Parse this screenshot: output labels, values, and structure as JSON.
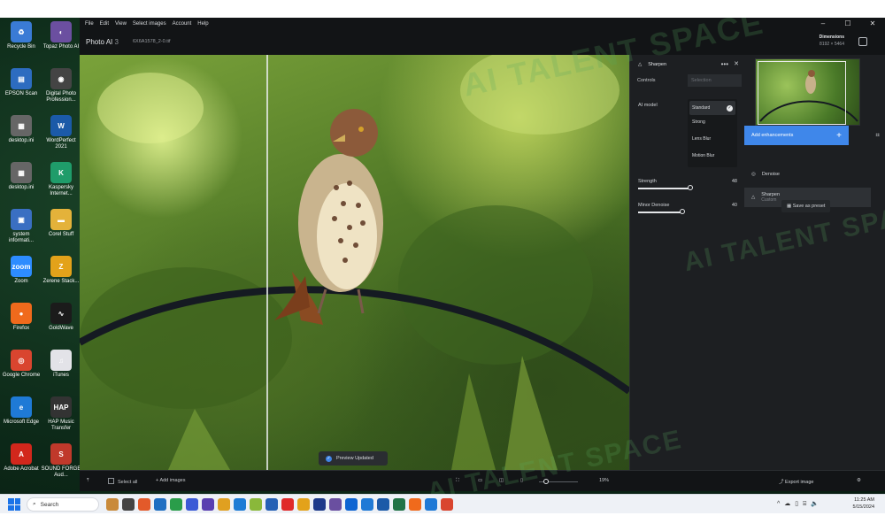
{
  "desktop": {
    "icons": [
      {
        "label": "Recycle Bin",
        "color": "#3a7bd5",
        "glyph": "♻"
      },
      {
        "label": "Topaz Photo AI",
        "color": "#6b4fa0",
        "glyph": "◐"
      },
      {
        "label": "EPSON Scan",
        "color": "#2d6cc0",
        "glyph": "▤"
      },
      {
        "label": "Digital Photo Profession...",
        "color": "#444",
        "glyph": "◉"
      },
      {
        "label": "desktop.ini",
        "color": "#666",
        "glyph": "▦"
      },
      {
        "label": "WordPerfect 2021",
        "color": "#1b5aa8",
        "glyph": "W"
      },
      {
        "label": "desktop.ini",
        "color": "#666",
        "glyph": "▦"
      },
      {
        "label": "Kaspersky Internet...",
        "color": "#1f9c6a",
        "glyph": "K"
      },
      {
        "label": "system informati...",
        "color": "#3a6fc2",
        "glyph": "▣"
      },
      {
        "label": "Corel Stuff",
        "color": "#e4b23a",
        "glyph": "▬"
      },
      {
        "label": "Zoom",
        "color": "#2d8cff",
        "glyph": "zoom"
      },
      {
        "label": "Zerene Stack...",
        "color": "#e3a21a",
        "glyph": "Z"
      },
      {
        "label": "Firefox",
        "color": "#f06a1c",
        "glyph": "●"
      },
      {
        "label": "GoldWave",
        "color": "#1b1b1b",
        "glyph": "∿"
      },
      {
        "label": "Google Chrome",
        "color": "#d9452f",
        "glyph": "◎"
      },
      {
        "label": "iTunes",
        "color": "#e3e3e8",
        "glyph": "♫"
      },
      {
        "label": "Microsoft Edge",
        "color": "#1f7ad6",
        "glyph": "e"
      },
      {
        "label": "HAP Music Transfer",
        "color": "#333",
        "glyph": "HAP"
      },
      {
        "label": "Adobe Acrobat",
        "color": "#d2271c",
        "glyph": "A"
      },
      {
        "label": "SOUND FORGE Aud...",
        "color": "#c0392b",
        "glyph": "S"
      }
    ]
  },
  "menu": {
    "items": [
      "File",
      "Edit",
      "View",
      "Select images",
      "Account",
      "Help"
    ]
  },
  "window_controls": {
    "min": "–",
    "max": "☐",
    "close": "✕"
  },
  "header": {
    "app_name": "Photo AI",
    "app_version": "3",
    "file_name": "6X6A1578_2-0.tif",
    "dimensions_label": "Dimensions",
    "dimensions_value": "8192 × 5464"
  },
  "preview": {
    "toast": "Preview Updated",
    "split_percent": 34
  },
  "sharpen_panel": {
    "title": "Sharpen",
    "more": "•••",
    "close": "✕",
    "tabs": [
      "Controls",
      "Selection"
    ],
    "ai_model_label": "AI model",
    "models": [
      "Standard",
      "Strong",
      "Lens Blur",
      "Motion Blur"
    ],
    "selected_model": "Standard",
    "sliders": [
      {
        "label": "Strength",
        "value": 48
      },
      {
        "label": "Minor Denoise",
        "value": 40
      }
    ]
  },
  "right_panel": {
    "add_enhancements": "Add enhancements",
    "enhancements": [
      {
        "name": "Denoise",
        "sub": ""
      },
      {
        "name": "Sharpen",
        "sub": "Custom"
      }
    ],
    "save_preset": "Save as preset"
  },
  "bottom_bar": {
    "select_all": "Select all",
    "add_images": "Add images",
    "zoom": "19%",
    "export": "Export image"
  },
  "watermark": {
    "text": "AI TALENT SPACE"
  },
  "taskbar": {
    "search_placeholder": "Search",
    "time": "11:25 AM",
    "date": "5/15/2024",
    "app_colors": [
      "#c98a3a",
      "#444",
      "#e35a2a",
      "#1f6fc2",
      "#2a9d4a",
      "#3b5bd6",
      "#5a3fb0",
      "#e0a020",
      "#1c7bd5",
      "#8ab83a",
      "#2561b5",
      "#e02a2a",
      "#e3a21a",
      "#1e3a8a",
      "#6a4fa0",
      "#0d64d2",
      "#1f7ad6",
      "#1b5aa8",
      "#217346",
      "#f06a1c",
      "#1f7ad6",
      "#d9452f"
    ]
  }
}
